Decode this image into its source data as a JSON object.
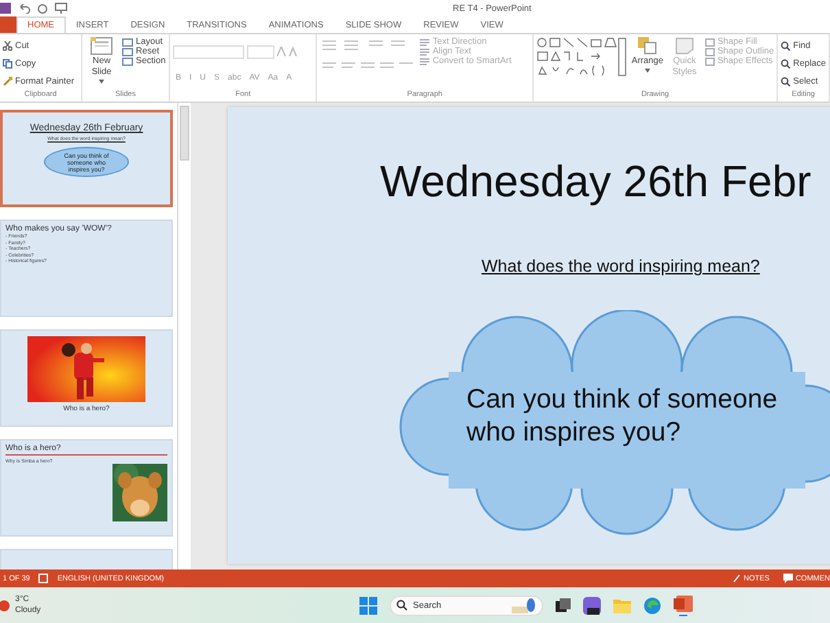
{
  "window": {
    "title": "RE T4 - PowerPoint"
  },
  "tabs": [
    {
      "label": "HOME",
      "selected": true
    },
    {
      "label": "INSERT",
      "selected": false
    },
    {
      "label": "DESIGN",
      "selected": false
    },
    {
      "label": "TRANSITIONS",
      "selected": false
    },
    {
      "label": "ANIMATIONS",
      "selected": false
    },
    {
      "label": "SLIDE SHOW",
      "selected": false
    },
    {
      "label": "REVIEW",
      "selected": false
    },
    {
      "label": "VIEW",
      "selected": false
    }
  ],
  "clipboard": {
    "label": "Clipboard",
    "buttons": [
      "Cut",
      "Copy",
      "Format Painter"
    ]
  },
  "slides_group": {
    "label": "Slides",
    "new_slide": "New Slide",
    "buttons": [
      "Layout",
      "Reset",
      "Section"
    ]
  },
  "font": {
    "label": "Font",
    "buttons": [
      "B",
      "I",
      "U",
      "S",
      "abc",
      "AV",
      "Aa",
      "A"
    ]
  },
  "paragraph": {
    "label": "Paragraph",
    "buttons": [
      {
        "label": "Text Direction",
        "disabled": true
      },
      {
        "label": "Align Text",
        "disabled": true
      },
      {
        "label": "Convert to SmartArt",
        "disabled": true
      }
    ]
  },
  "drawing": {
    "label": "Drawing",
    "arrange": "Arrange",
    "quick_styles": "Quick Styles",
    "buttons": [
      {
        "label": "Shape Fill",
        "disabled": true
      },
      {
        "label": "Shape Outline",
        "disabled": true
      },
      {
        "label": "Shape Effects",
        "disabled": true
      }
    ]
  },
  "editing": {
    "label": "Editing",
    "buttons": [
      "Find",
      "Replace",
      "Select"
    ]
  },
  "thumbnails": [
    {
      "kind": "title",
      "selected": true,
      "title": "Wednesday 26th February",
      "subtitle": "What does the word inspiring mean?",
      "cloud": "Can you think of someone who inspires you?"
    },
    {
      "kind": "list",
      "selected": false,
      "title": "Who makes you say 'WOW'?",
      "lines": [
        "- Friends?",
        "- Family?",
        "- Teachers?",
        "- Celebrities?",
        "- Historical figures?"
      ]
    },
    {
      "kind": "picture",
      "selected": false,
      "caption": "Who is a hero?"
    },
    {
      "kind": "picture_right",
      "selected": false,
      "title": "Who is a hero?",
      "text": "Why is Simba a hero?"
    },
    {
      "kind": "blank",
      "selected": false
    }
  ],
  "slide": {
    "title": "Wednesday 26th Febr",
    "subtitle": "What does the word inspiring mean?",
    "cloud_lines": [
      "Can you think of someone",
      "who inspires you?"
    ]
  },
  "status_bar": {
    "slide_count": "1 OF 39",
    "language": "ENGLISH (UNITED KINGDOM)",
    "notes": "NOTES",
    "comments": "COMMEN"
  },
  "taskbar": {
    "weather_temp": "3°C",
    "weather_text": "Cloudy",
    "search": "Search"
  }
}
